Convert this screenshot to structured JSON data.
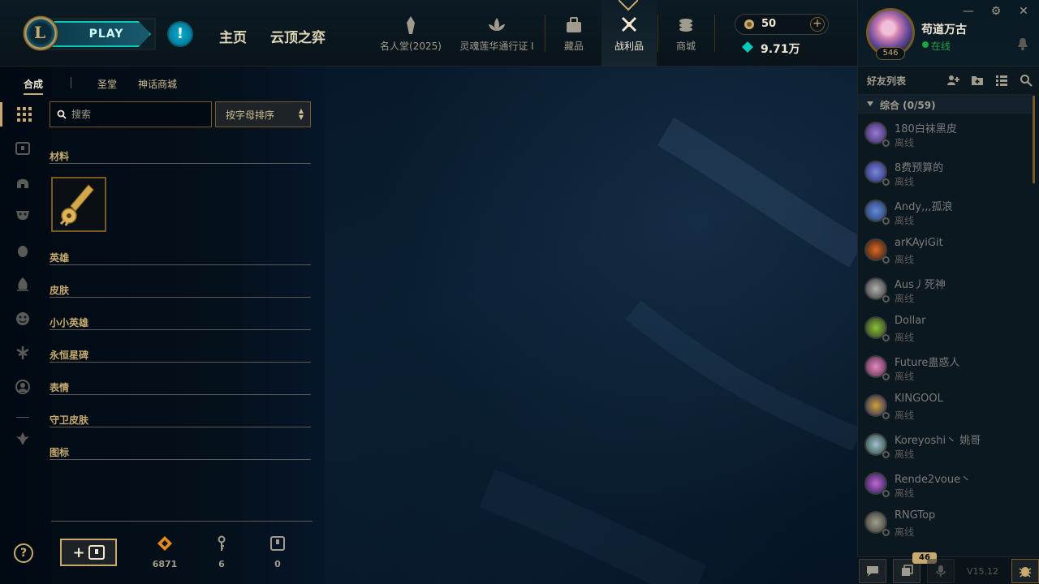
{
  "header": {
    "play_label": "PLAY",
    "alert_icon": "!",
    "nav_home": "主页",
    "nav_tft": "云顶之弈",
    "nav_items": [
      {
        "label": "名人堂(2025)",
        "icon": "hall-of-legends-icon"
      },
      {
        "label": "灵魂莲华通行证 I",
        "icon": "lotus-pass-icon"
      },
      {
        "label": "藏品",
        "icon": "collection-icon"
      },
      {
        "label": "战利品",
        "icon": "loot-icon",
        "active": true
      },
      {
        "label": "商城",
        "icon": "store-icon"
      }
    ],
    "rp_amount": "50",
    "rp_add": "+",
    "be_amount": "9.71万"
  },
  "profile": {
    "name": "苟道万古",
    "status": "在线",
    "level": "546"
  },
  "window": {
    "minimize": "—",
    "settings": "⚙",
    "close": "✕"
  },
  "loot": {
    "tabs": [
      "合成",
      "圣堂",
      "神话商城"
    ],
    "search_placeholder": "搜索",
    "sort_label": "按字母排序",
    "categories": [
      "材料",
      "英雄",
      "皮肤",
      "小小英雄",
      "永恒星碑",
      "表情",
      "守卫皮肤",
      "图标"
    ],
    "add_chest_label": "+",
    "resources": [
      {
        "icon": "orange-essence-icon",
        "value": "6871"
      },
      {
        "icon": "key-fragment-icon",
        "value": "6"
      },
      {
        "icon": "chest-icon",
        "value": "0"
      }
    ]
  },
  "friends": {
    "title": "好友列表",
    "group_label": "综合 (0/59)",
    "list": [
      {
        "name": "180白袜黑皮",
        "status": "离线"
      },
      {
        "name": "8费预算的",
        "status": "离线"
      },
      {
        "name": "Andy,,,孤浪",
        "status": "离线"
      },
      {
        "name": "arKAyiGit",
        "status": "离线"
      },
      {
        "name": "Aus丿死神",
        "status": "离线"
      },
      {
        "name": "Dollar",
        "status": "离线"
      },
      {
        "name": "Future蛊惑人",
        "status": "离线"
      },
      {
        "name": "KINGOOL",
        "status": "离线"
      },
      {
        "name": "Koreyoshi丶 姚哥",
        "status": "离线"
      },
      {
        "name": "Rende2voue丶",
        "status": "离线"
      },
      {
        "name": "RNGTop",
        "status": "离线"
      }
    ],
    "footer_badge": "46",
    "version": "V15.12"
  },
  "help_label": "?",
  "colors": {
    "gold": "#c8aa6e",
    "teal": "#0ac8b9",
    "online": "#1ea33e",
    "offline": "#5b5a56"
  }
}
